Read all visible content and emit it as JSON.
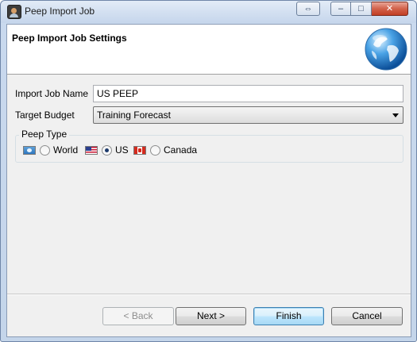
{
  "window": {
    "title": "Peep Import Job",
    "controls": {
      "restore": "⇔",
      "minimize": "–",
      "maximize": "□",
      "close": "✕"
    }
  },
  "header": {
    "title": "Peep Import Job Settings",
    "icon": "globe-icon"
  },
  "form": {
    "job_name_label": "Import Job Name",
    "job_name_value": "US PEEP",
    "budget_label": "Target Budget",
    "budget_value": "Training Forecast"
  },
  "peep_type": {
    "legend": "Peep Type",
    "options": [
      {
        "label": "World",
        "flag": "world-flag-icon",
        "checked": false
      },
      {
        "label": "US",
        "flag": "us-flag-icon",
        "checked": true
      },
      {
        "label": "Canada",
        "flag": "canada-flag-icon",
        "checked": false
      }
    ]
  },
  "buttons": {
    "back": "< Back",
    "next": "Next >",
    "finish": "Finish",
    "cancel": "Cancel"
  }
}
